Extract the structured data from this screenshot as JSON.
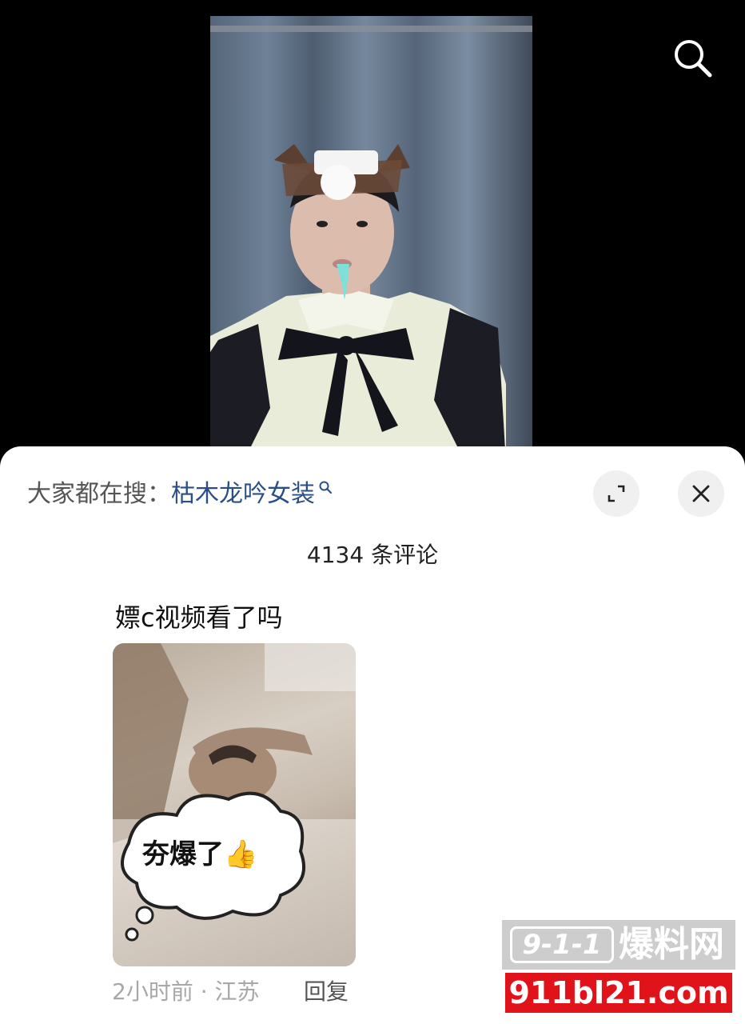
{
  "header": {
    "search_icon": "search-icon"
  },
  "sheet": {
    "trending_prefix": "大家都在搜：",
    "trending_term": "枯木龙吟女装",
    "expand_icon": "expand-icon",
    "close_icon": "close-icon",
    "comment_count": "4134 条评论"
  },
  "comments": [
    {
      "text": "嫖c视频看了吗",
      "image_sticker_text": "夯爆了👍",
      "meta": "2小时前 · 江苏",
      "reply_label": "回复"
    }
  ],
  "watermark": {
    "logo": "9-1-1",
    "brand_cn": "爆料网",
    "url": "911bl21.com"
  },
  "colors": {
    "trending_term": "#2a4f86",
    "watermark_red": "#e0131b"
  }
}
